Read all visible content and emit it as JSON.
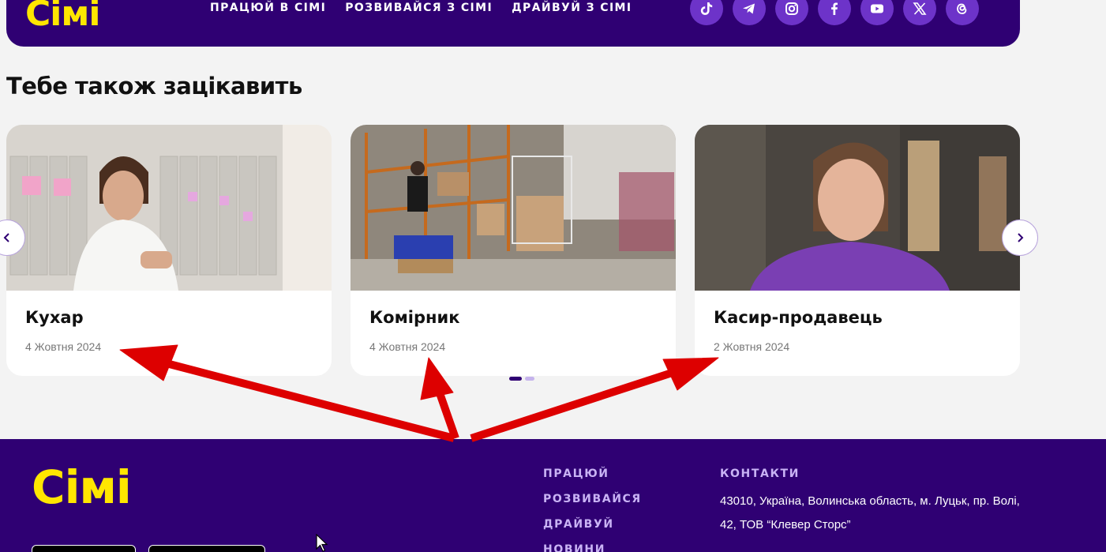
{
  "header": {
    "logo": "Сімі",
    "nav": [
      "ПРАЦЮЙ В СІМІ",
      "РОЗВИВАЙСЯ З СІМІ",
      "ДРАЙВУЙ З СІМІ"
    ],
    "socials": [
      "tiktok-icon",
      "telegram-icon",
      "instagram-icon",
      "facebook-icon",
      "youtube-icon",
      "x-icon",
      "threads-icon"
    ]
  },
  "section": {
    "title": "Тебе також зацікавить"
  },
  "cards": [
    {
      "title": "Кухар",
      "date": "4 Жовтня 2024"
    },
    {
      "title": "Комірник",
      "date": "4 Жовтня 2024"
    },
    {
      "title": "Касир-продавець",
      "date": "2 Жовтня 2024"
    }
  ],
  "carousel": {
    "active_page": 1,
    "pages": 2
  },
  "footer": {
    "logo": "Сімі",
    "nav": [
      "ПРАЦЮЙ",
      "РОЗВИВАЙСЯ",
      "ДРАЙВУЙ",
      "НОВИНИ"
    ],
    "contacts_heading": "КОНТАКТИ",
    "address": "43010, Україна, Волинська область, м. Луцьк, пр. Волі, 42, ТОВ “Клевер Сторс”"
  },
  "colors": {
    "brand_purple": "#2f0073",
    "brand_yellow": "#ffe600",
    "social_purple": "#6d33c9",
    "annotation_red": "#dd0000"
  }
}
